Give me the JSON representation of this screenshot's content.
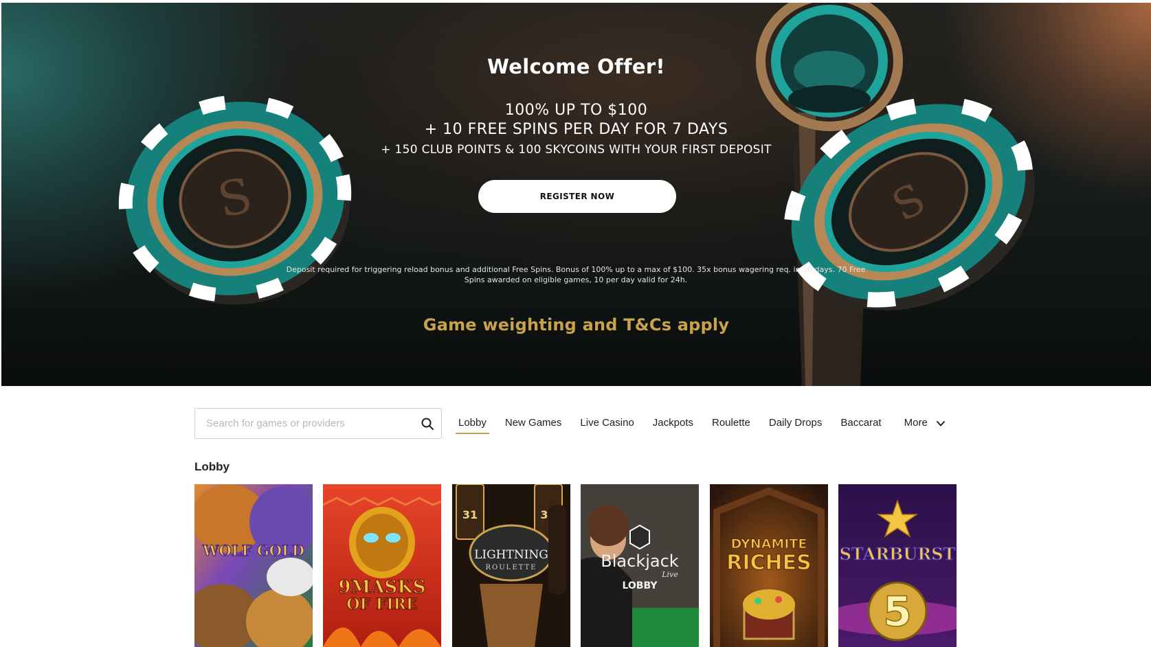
{
  "hero": {
    "title": "Welcome Offer!",
    "line1": "100% UP TO $100",
    "line2": "+ 10 FREE SPINS PER DAY FOR 7 DAYS",
    "line3": "+ 150 CLUB POINTS & 100 SKYCOINS WITH YOUR FIRST DEPOSIT",
    "cta_label": "REGISTER NOW",
    "terms": "Deposit required for triggering reload bonus and additional Free Spins. Bonus of 100% up to a max of $100. 35x bonus wagering req. in 30 days. 70 Free Spins awarded on eligible games, 10 per day valid for 24h.",
    "tcs": "Game weighting and T&Cs apply"
  },
  "search": {
    "placeholder": "Search for games or providers",
    "value": ""
  },
  "nav": {
    "items": [
      "Lobby",
      "New Games",
      "Live Casino",
      "Jackpots",
      "Roulette",
      "Daily Drops",
      "Baccarat"
    ],
    "active": "Lobby",
    "more_label": "More"
  },
  "section": {
    "title": "Lobby"
  },
  "games": [
    {
      "id": "wolf-gold",
      "title_line1": "WOLF GOLD",
      "title_line2": ""
    },
    {
      "id": "9-masks-of-fire",
      "title_line1": "9MASKS",
      "title_line2": "OF FIRE"
    },
    {
      "id": "lightning-roulette",
      "title_line1": "LIGHTNING",
      "title_line2": "ROULETTE",
      "number_left": "31",
      "number_right": "3"
    },
    {
      "id": "blackjack-live-lobby",
      "title_line1": "Blackjack",
      "title_line2": "LOBBY",
      "tag": "Live"
    },
    {
      "id": "dynamite-riches",
      "title_line1": "DYNAMITE",
      "title_line2": "RICHES"
    },
    {
      "id": "starburst",
      "title_line1": "STARBURST",
      "title_line2": "5"
    }
  ],
  "colors": {
    "accent_gold": "#c9a24c",
    "hero_teal": "#1f8c86",
    "cta_bg": "#ffffff"
  }
}
